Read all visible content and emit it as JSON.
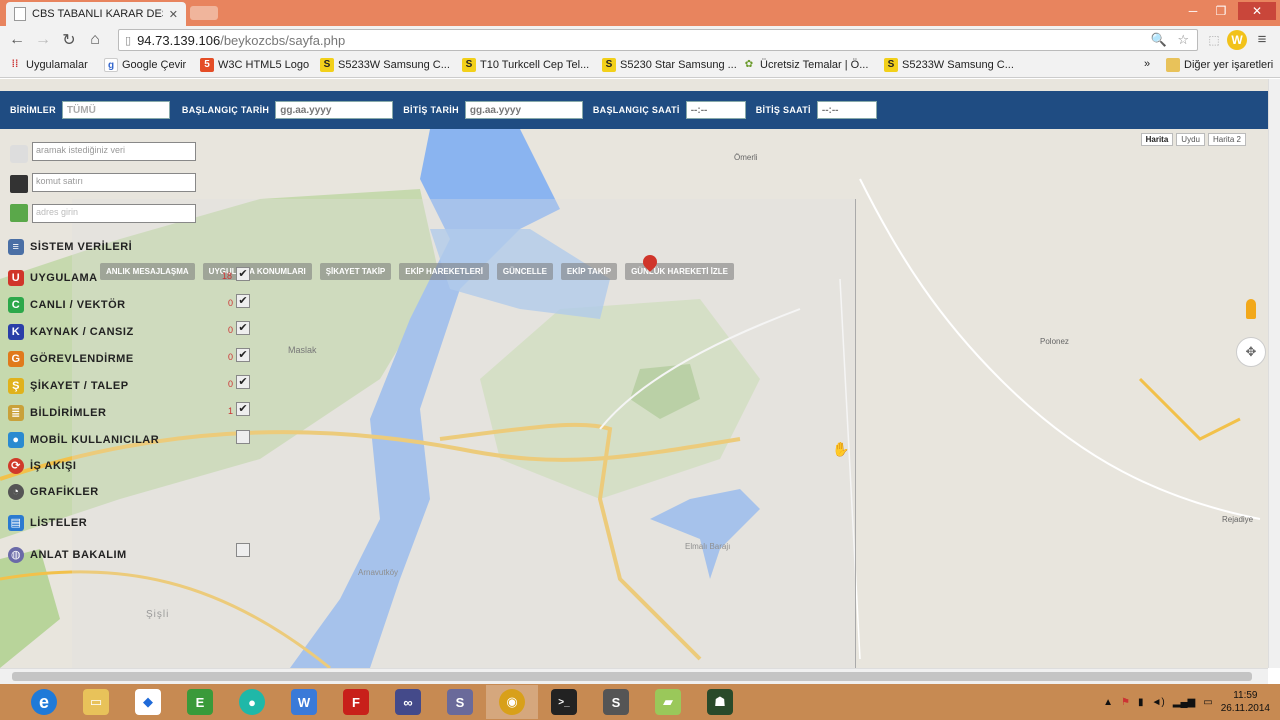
{
  "browser": {
    "tab_title": "CBS TABANLI KARAR DES",
    "url": "94.73.139.106/beykozcbs/sayfa.php",
    "url_host": "94.73.139.106",
    "url_path": "/beykozcbs/sayfa.php",
    "bookmarks": [
      {
        "label": "Uygulamalar",
        "icon": "apps-grid-icon"
      },
      {
        "label": "Google Çevir",
        "icon": "google-translate-icon"
      },
      {
        "label": "W3C HTML5 Logo",
        "icon": "w3c-icon"
      },
      {
        "label": "S5233W Samsung C...",
        "icon": "s-icon"
      },
      {
        "label": "T10 Turkcell Cep Tel...",
        "icon": "s-icon"
      },
      {
        "label": "S5230 Star Samsung ...",
        "icon": "s-icon"
      },
      {
        "label": "Ücretsiz Temalar | Ö...",
        "icon": "theme-icon"
      },
      {
        "label": "S5233W Samsung C...",
        "icon": "s-icon"
      }
    ],
    "bookmarks_more": "»",
    "other_bookmarks": "Diğer yer işaretleri"
  },
  "filters": {
    "units_label": "BİRİMLER",
    "units_value": "TÜMÜ",
    "start_date_label": "BAŞLANGIÇ TARİH",
    "start_date_placeholder": "gg.aa.yyyy",
    "end_date_label": "BİTİŞ TARİH",
    "end_date_placeholder": "gg.aa.yyyy",
    "start_time_label": "BAŞLANGIÇ SAATİ",
    "start_time_placeholder": "--:--",
    "end_time_label": "BİTİŞ SAATİ",
    "end_time_placeholder": "--:--"
  },
  "map_types": [
    "Harita",
    "Uydu",
    "Harita 2"
  ],
  "sidebar": {
    "search_placeholder": "aramak istediğiniz veri",
    "command_placeholder": "komut satırı",
    "address_placeholder": "adres girin",
    "menu": [
      {
        "label": "SİSTEM VERİLERİ",
        "icon": "database-icon",
        "color": "#4a6fa5",
        "glyph": "≡"
      },
      {
        "label": "UYGULAMA",
        "icon": "u-icon",
        "color": "#d0352a",
        "glyph": "U"
      },
      {
        "label": "CANLI / VEKTÖR",
        "icon": "c-icon",
        "color": "#2ca84a",
        "glyph": "C"
      },
      {
        "label": "KAYNAK / CANSIZ",
        "icon": "k-icon",
        "color": "#2a3fa8",
        "glyph": "K"
      },
      {
        "label": "GÖREVLENDİRME",
        "icon": "g-icon",
        "color": "#e07a1c",
        "glyph": "G"
      },
      {
        "label": "ŞİKAYET / TALEP",
        "icon": "s-icon",
        "color": "#e0b21c",
        "glyph": "Ş"
      },
      {
        "label": "BİLDİRİMLER",
        "icon": "stack-icon",
        "color": "#c9a13a",
        "glyph": "≣"
      },
      {
        "label": "MOBİL KULLANICILAR",
        "icon": "map-pin-icon",
        "color": "#2a8ad0",
        "glyph": "●"
      },
      {
        "label": "İŞ AKIŞI",
        "icon": "workflow-icon",
        "color": "#d03a2a",
        "glyph": "⟳"
      },
      {
        "label": "GRAFİKLER",
        "icon": "pie-chart-icon",
        "color": "#555555",
        "glyph": "◔"
      },
      {
        "label": "LİSTELER",
        "icon": "clipboard-icon",
        "color": "#2a7ad0",
        "glyph": "▤"
      },
      {
        "label": "ANLAT BAKALIM",
        "icon": "globe-icon",
        "color": "#6a6aa8",
        "glyph": "◍"
      }
    ],
    "counts": [
      "18",
      "0",
      "0",
      "0",
      "0",
      "1"
    ]
  },
  "popup_buttons": [
    "ANLIK MESAJLAŞMA",
    "UYGULAMA KONUMLARI",
    "ŞİKAYET TAKİP",
    "EKİP HAREKETLERİ",
    "GÜNCELLE",
    "EKİP TAKİP",
    "GÜNLÜK HAREKETİ İZLE"
  ],
  "map_labels": [
    "Maslak",
    "Şişli",
    "Polonez",
    "Rejadiye",
    "Ömerli",
    "Elmalı Barajı",
    "Arnavutköy"
  ],
  "taskbar": {
    "apps": [
      {
        "icon": "internet-explorer-icon",
        "color": "#1f7ad8",
        "glyph": "e"
      },
      {
        "icon": "file-explorer-icon",
        "color": "#e8c25a",
        "glyph": "▭"
      },
      {
        "icon": "dropbox-icon",
        "color": "#1f6ad8",
        "glyph": "◆"
      },
      {
        "icon": "evernote-icon",
        "color": "#3a9a3a",
        "glyph": "E"
      },
      {
        "icon": "teal-app-icon",
        "color": "#1fb8a8",
        "glyph": "●"
      },
      {
        "icon": "webstorm-icon",
        "color": "#3a7ad8",
        "glyph": "W"
      },
      {
        "icon": "filezilla-icon",
        "color": "#c8201a",
        "glyph": "F"
      },
      {
        "icon": "visual-studio-icon",
        "color": "#444a8a",
        "glyph": "∞"
      },
      {
        "icon": "sublime-text-icon",
        "color": "#6a6a9a",
        "glyph": "S"
      },
      {
        "icon": "chrome-icon",
        "color": "#d8a01a",
        "glyph": "◉"
      },
      {
        "icon": "terminal-icon",
        "color": "#222222",
        "glyph": ">_"
      },
      {
        "icon": "sublime-icon",
        "color": "#555555",
        "glyph": "S"
      },
      {
        "icon": "folder-map-icon",
        "color": "#9ac85a",
        "glyph": "▰"
      },
      {
        "icon": "android-icon",
        "color": "#2a4a2a",
        "glyph": "☗"
      }
    ],
    "time": "11:59",
    "date": "26.11.2014"
  }
}
